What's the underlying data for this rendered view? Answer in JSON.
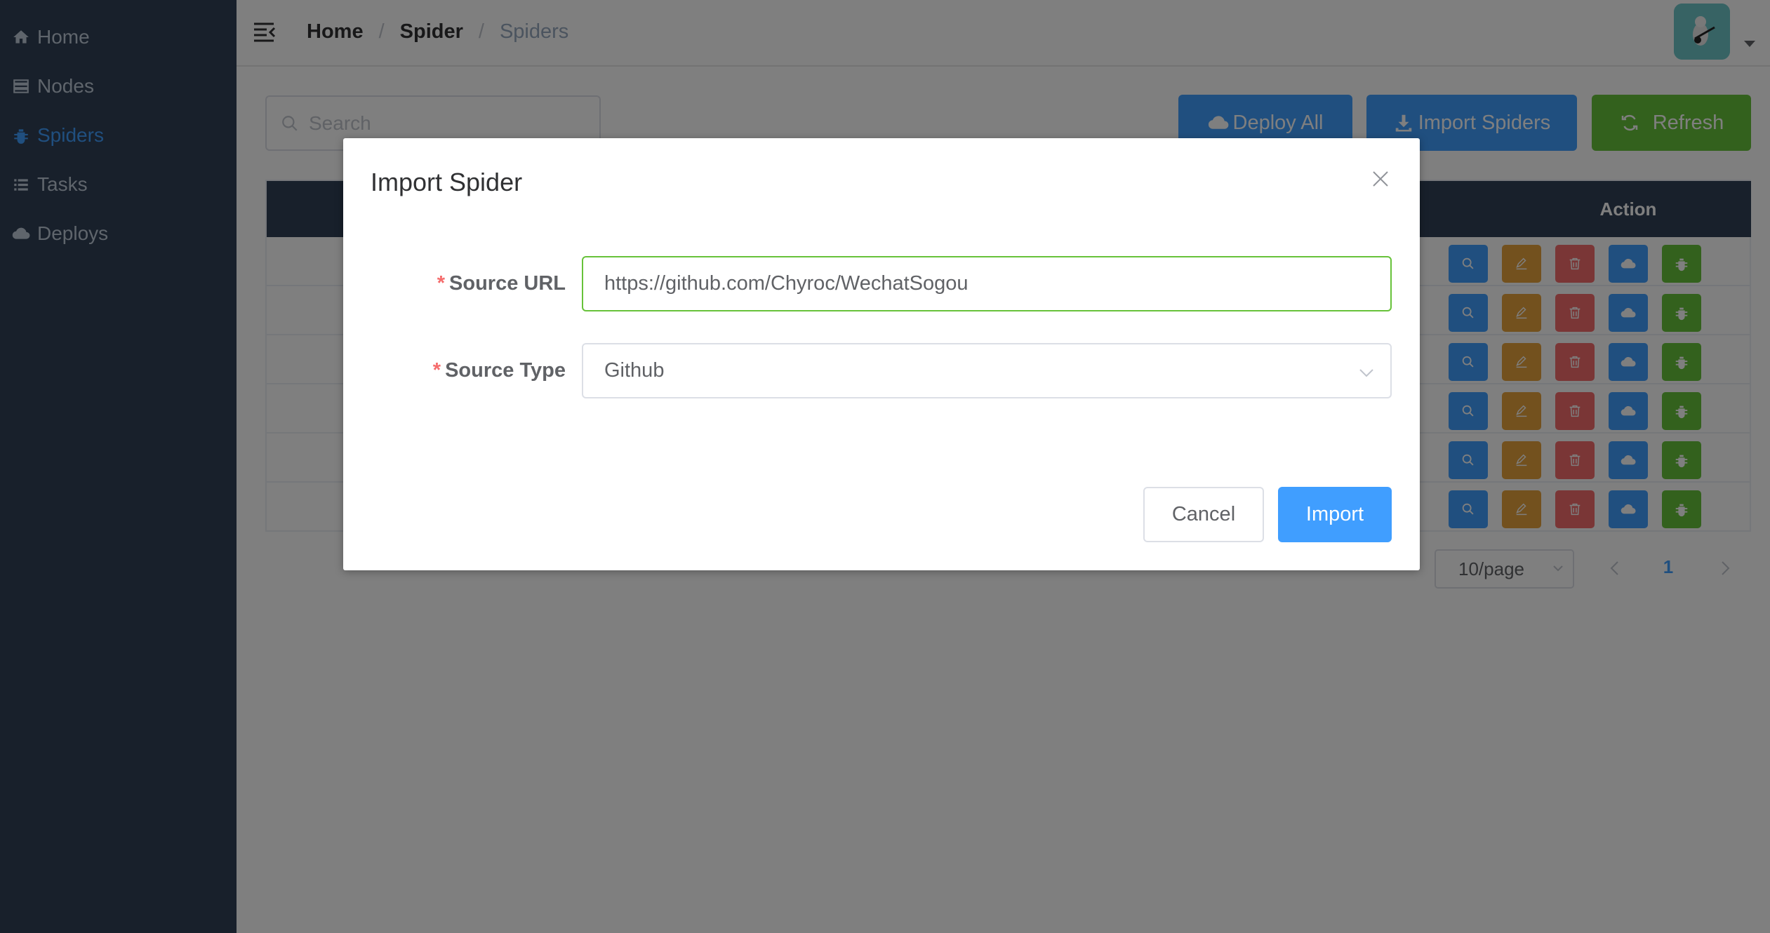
{
  "sidebar": {
    "items": [
      {
        "label": "Home",
        "icon": "home-icon",
        "active": false
      },
      {
        "label": "Nodes",
        "icon": "server-icon",
        "active": false
      },
      {
        "label": "Spiders",
        "icon": "bug-icon",
        "active": true
      },
      {
        "label": "Tasks",
        "icon": "list-icon",
        "active": false
      },
      {
        "label": "Deploys",
        "icon": "cloud-icon",
        "active": false
      }
    ]
  },
  "header": {
    "breadcrumb": [
      "Home",
      "Spider",
      "Spiders"
    ],
    "separator": "/"
  },
  "toolbar": {
    "search_placeholder": "Search",
    "deploy_all_label": "Deploy All",
    "import_spiders_label": "Import Spiders",
    "refresh_label": "Refresh"
  },
  "table": {
    "action_header": "Action",
    "row_count": 6,
    "row_actions": [
      "view-icon",
      "edit-icon",
      "delete-icon",
      "deploy-icon",
      "run-icon"
    ]
  },
  "pagination": {
    "page_size": "10/page",
    "current_page": "1"
  },
  "dialog": {
    "title": "Import Spider",
    "required_mark": "*",
    "source_url_label": "Source URL",
    "source_url_value": "https://github.com/Chyroc/WechatSogou",
    "source_type_label": "Source Type",
    "source_type_value": "Github",
    "cancel_label": "Cancel",
    "import_label": "Import"
  },
  "colors": {
    "sidebar_bg": "#304156",
    "sidebar_text": "#bfcbd9",
    "active": "#409eff",
    "primary": "#409eff",
    "success": "#67c23a",
    "warning": "#e6a23c",
    "danger": "#f56c6c",
    "valid_border": "#67c23a"
  }
}
